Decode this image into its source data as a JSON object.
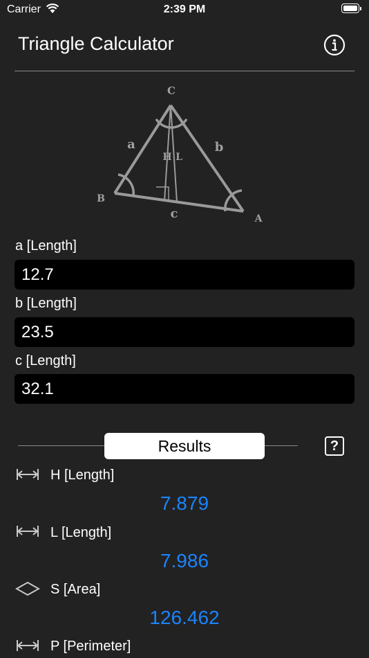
{
  "status_bar": {
    "carrier": "Carrier",
    "time": "2:39 PM"
  },
  "header": {
    "title": "Triangle Calculator"
  },
  "diagram": {
    "vertex_c": "C",
    "vertex_b": "B",
    "vertex_a": "A",
    "side_a": "a",
    "side_b": "b",
    "side_c": "c",
    "height_label": "H",
    "length_label": "L"
  },
  "inputs": [
    {
      "label": "a [Length]",
      "value": "12.7"
    },
    {
      "label": "b [Length]",
      "value": "23.5"
    },
    {
      "label": "c [Length]",
      "value": "32.1"
    }
  ],
  "results_tab": {
    "label": "Results",
    "help": "?"
  },
  "results": [
    {
      "label": "H [Length]",
      "value": "7.879",
      "icon": "length-arrows-icon"
    },
    {
      "label": "L [Length]",
      "value": "7.986",
      "icon": "length-arrows-icon"
    },
    {
      "label": "S [Area]",
      "value": "126.462",
      "icon": "area-rhombus-icon"
    },
    {
      "label": "P [Perimeter]",
      "value": "",
      "icon": "length-arrows-icon"
    }
  ],
  "colors": {
    "background": "#222222",
    "accent": "#1a84ff",
    "input_background": "#000000"
  }
}
